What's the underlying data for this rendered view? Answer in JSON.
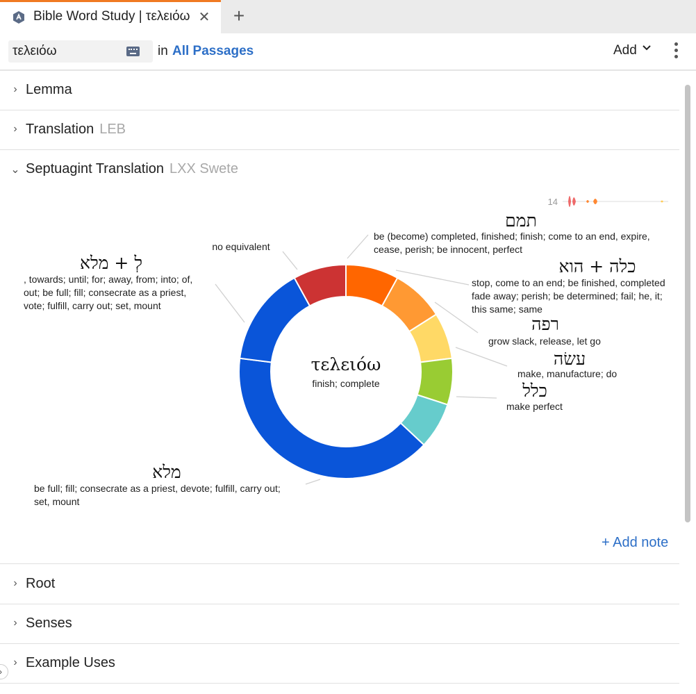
{
  "tab": {
    "title": "Bible Word Study | τελειόω",
    "close_glyph": "✕",
    "add_glyph": "+"
  },
  "search": {
    "value": "τελειόω",
    "in_label": "in",
    "passages": "All Passages"
  },
  "toolbar": {
    "add_label": "Add",
    "add_chevron": "⌄"
  },
  "sections": [
    {
      "title": "Lemma",
      "subtitle": "",
      "expanded": false
    },
    {
      "title": "Translation",
      "subtitle": "LEB",
      "expanded": false
    },
    {
      "title": "Septuagint Translation",
      "subtitle": "LXX Swete",
      "expanded": true
    },
    {
      "title": "Root",
      "subtitle": "",
      "expanded": false
    },
    {
      "title": "Senses",
      "subtitle": "",
      "expanded": false
    },
    {
      "title": "Example Uses",
      "subtitle": "",
      "expanded": false
    }
  ],
  "timeline": {
    "count_label": "14"
  },
  "add_note": "+ Add note",
  "chart_data": {
    "type": "pie",
    "donut": true,
    "center_word": "τελειόω",
    "center_gloss": "finish; complete",
    "segments": [
      {
        "label": "תמם",
        "gloss_lines": [
          "be (become) completed, finished; finish; come to an end, expire,",
          "cease, perish; be innocent, perfect"
        ],
        "value": 8,
        "color": "#ff6600"
      },
      {
        "label": "כלה + הוא",
        "gloss_lines": [
          "stop, come to an end; be finished, completed",
          "fade away; perish; be determined; fail; he, it;",
          "this same; same"
        ],
        "value": 8,
        "color": "#ff9933"
      },
      {
        "label": "רפה",
        "gloss_lines": [
          "grow slack, release, let go"
        ],
        "value": 7,
        "color": "#ffd966"
      },
      {
        "label": "עשׂה",
        "gloss_lines": [
          "make, manufacture; do"
        ],
        "value": 7,
        "color": "#99cc33"
      },
      {
        "label": "כלל",
        "gloss_lines": [
          "make perfect"
        ],
        "value": 7,
        "color": "#66cccc"
      },
      {
        "label": "מלא",
        "gloss_lines": [
          "be full; fill; consecrate as a priest, devote; fulfill, carry out;",
          "set, mount"
        ],
        "value": 40,
        "color": "#0a55d9"
      },
      {
        "label": "לְ + מלא",
        "gloss_lines": [
          ", towards; until; for; away, from; into; of,",
          "out; be full; fill; consecrate as a priest,",
          "vote; fulfill, carry out; set, mount"
        ],
        "value": 15,
        "color": "#0a55d9"
      },
      {
        "label": "",
        "gloss_lines": [
          "no equivalent"
        ],
        "value": 8,
        "color": "#cc3333"
      }
    ]
  }
}
